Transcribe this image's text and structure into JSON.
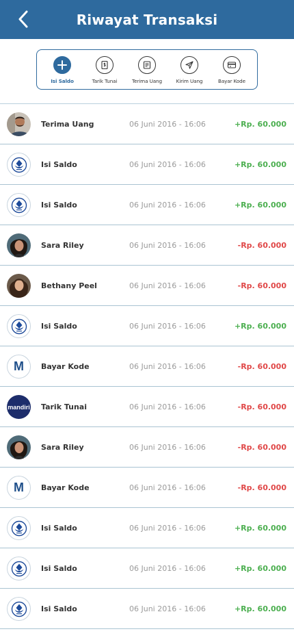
{
  "header": {
    "title": "Riwayat Transaksi",
    "back_icon": "chevron-left-icon"
  },
  "filters": [
    {
      "label": "Isi Saldo",
      "icon": "plus-icon",
      "active": true
    },
    {
      "label": "Tarik Tunai",
      "icon": "cash-icon",
      "active": false
    },
    {
      "label": "Terima Uang",
      "icon": "receipt-icon",
      "active": false
    },
    {
      "label": "Kirim Uang",
      "icon": "send-icon",
      "active": false
    },
    {
      "label": "Bayar Kode",
      "icon": "card-icon",
      "active": false
    }
  ],
  "transactions": [
    {
      "name": "Terima Uang",
      "date": "06 Juni 2016 - 16:06",
      "amount": "+Rp. 60.000",
      "avatar": "person-man"
    },
    {
      "name": "Isi Saldo",
      "date": "06 Juni 2016 - 16:06",
      "amount": "+Rp. 60.000",
      "avatar": "bank-logo"
    },
    {
      "name": "Isi Saldo",
      "date": "06 Juni 2016 - 16:06",
      "amount": "+Rp. 60.000",
      "avatar": "bank-logo"
    },
    {
      "name": "Sara Riley",
      "date": "06 Juni 2016 - 16:06",
      "amount": "-Rp. 60.000",
      "avatar": "person-woman-1"
    },
    {
      "name": "Bethany Peel",
      "date": "06 Juni 2016 - 16:06",
      "amount": "-Rp. 60.000",
      "avatar": "person-woman-2"
    },
    {
      "name": "Isi Saldo",
      "date": "06 Juni 2016 - 16:06",
      "amount": "+Rp. 60.000",
      "avatar": "bank-logo"
    },
    {
      "name": "Bayar Kode",
      "date": "06 Juni 2016 - 16:06",
      "amount": "-Rp. 60.000",
      "avatar": "m-letter",
      "avatar_text": "M"
    },
    {
      "name": "Tarik Tunai",
      "date": "06 Juni 2016 - 16:06",
      "amount": "-Rp. 60.000",
      "avatar": "mandiri-logo",
      "avatar_text": "mandiri"
    },
    {
      "name": "Sara Riley",
      "date": "06 Juni 2016 - 16:06",
      "amount": "-Rp. 60.000",
      "avatar": "person-woman-1"
    },
    {
      "name": "Bayar Kode",
      "date": "06 Juni 2016 - 16:06",
      "amount": "-Rp. 60.000",
      "avatar": "m-letter",
      "avatar_text": "M"
    },
    {
      "name": "Isi Saldo",
      "date": "06 Juni 2016 - 16:06",
      "amount": "+Rp. 60.000",
      "avatar": "bank-logo"
    },
    {
      "name": "Isi Saldo",
      "date": "06 Juni 2016 - 16:06",
      "amount": "+Rp. 60.000",
      "avatar": "bank-logo"
    },
    {
      "name": "Isi Saldo",
      "date": "06 Juni 2016 - 16:06",
      "amount": "+Rp. 60.000",
      "avatar": "bank-logo"
    }
  ],
  "colors": {
    "primary": "#2e6a9e",
    "positive": "#4caf50",
    "negative": "#e04848"
  }
}
